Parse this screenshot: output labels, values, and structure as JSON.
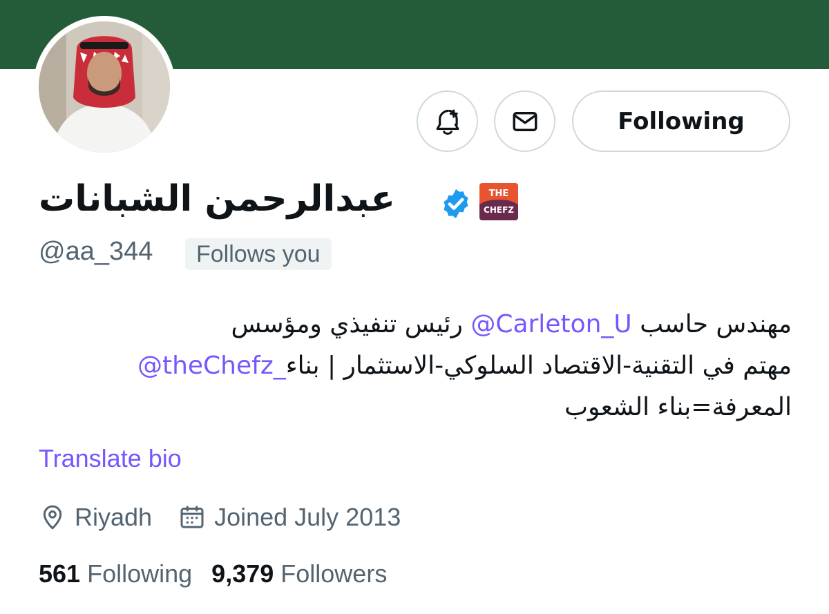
{
  "profile": {
    "display_name": "عبدالرحمن الشبانات",
    "handle": "@aa_344",
    "follows_you_label": "Follows you",
    "verified_icon": "verified-badge-icon",
    "affiliate_badge": {
      "line1": "THE",
      "line2": "CHEFZ",
      "colors": {
        "top": "#e8542f",
        "bottom": "#6a2a4e"
      }
    }
  },
  "actions": {
    "notify_icon": "bell-plus-icon",
    "message_icon": "envelope-icon",
    "follow_label": "Following"
  },
  "bio": {
    "line1_text": "مهندس حاسب ",
    "line1_mention": "@Carleton_U",
    "line1_tail": " رئيس تنفيذي ومؤسس",
    "line2_mention": "@theChefz_",
    "line2_text": " مهتم في التقنية-الاقتصاد السلوكي-الاستثمار | بناء",
    "line3_text": "المعرفة=بناء الشعوب",
    "translate_label": "Translate bio"
  },
  "meta": {
    "location": "Riyadh",
    "joined": "Joined July 2013"
  },
  "stats": {
    "following_count": "561",
    "following_label": "Following",
    "followers_count": "9,379",
    "followers_label": "Followers"
  },
  "colors": {
    "banner": "#245c3a",
    "accent": "#7856ff",
    "verified": "#1d9bf0",
    "muted_text": "#536471"
  }
}
